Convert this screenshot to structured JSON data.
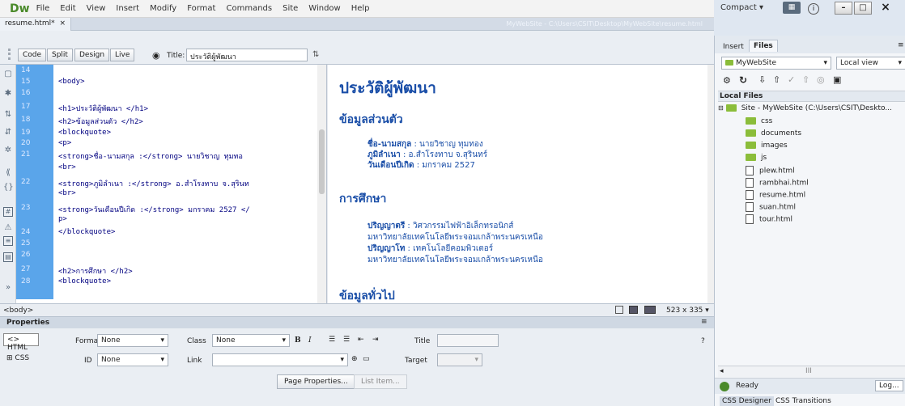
{
  "app": {
    "logo": "Dw",
    "menus": [
      "File",
      "Edit",
      "View",
      "Insert",
      "Modify",
      "Format",
      "Commands",
      "Site",
      "Window",
      "Help"
    ]
  },
  "window": {
    "workspace": "Compact",
    "workspace_arrow": "▾",
    "min": "–",
    "max": "□",
    "close": "×"
  },
  "document": {
    "tab": "resume.html*",
    "tab_close": "×",
    "path": "MyWebSite - C:\\Users\\CSIT\\Desktop\\MyWebSite\\resume.html"
  },
  "toolbar": {
    "views": [
      "Code",
      "Split",
      "Design",
      "Live"
    ],
    "title_label": "Title:",
    "title_value": "ประวัติผู้พัฒนา"
  },
  "code": {
    "lines": [
      {
        "n": "14",
        "text": ""
      },
      {
        "n": "15",
        "text": "<body>"
      },
      {
        "n": "16",
        "text": ""
      },
      {
        "n": "17",
        "text": "<h1>ประวัติผู้พัฒนา </h1>"
      },
      {
        "n": "18",
        "text": "<h2>ข้อมูลส่วนตัว </h2>"
      },
      {
        "n": "19",
        "text": "<blockquote>"
      },
      {
        "n": "20",
        "text": "  <p>"
      },
      {
        "n": "21",
        "text": "    <strong>ชื่อ-นามสกุล :</strong> นายวิชาญ ทุมทอ"
      },
      {
        "n": "",
        "text": "  <br>"
      },
      {
        "n": "22",
        "text": "    <strong>ภูมิลำเนา :</strong> อ.สำโรงทาบ จ.สุรินท"
      },
      {
        "n": "",
        "text": "  <br>"
      },
      {
        "n": "23",
        "text": "  <strong>วันเดือนปีเกิด :</strong> มกราคม 2527 </"
      },
      {
        "n": "",
        "text": "p>"
      },
      {
        "n": "24",
        "text": "</blockquote>"
      },
      {
        "n": "25",
        "text": ""
      },
      {
        "n": "26",
        "text": ""
      },
      {
        "n": "27",
        "text": "  <h2>การศึกษา </h2>"
      },
      {
        "n": "28",
        "text": "  <blockquote>"
      }
    ]
  },
  "design": {
    "h1": "ประวัติผู้พัฒนา",
    "h2_personal": "ข้อมูลส่วนตัว",
    "personal": [
      {
        "label": "ชื่อ-นามสกุล",
        "value": " : นายวิชาญ ทุมทอง"
      },
      {
        "label": "ภูมิลำเนา",
        "value": " : อ.สำโรงทาบ จ.สุรินทร์"
      },
      {
        "label": "วันเดือนปีเกิด",
        "value": " : มกราคม 2527"
      }
    ],
    "h2_edu": "การศึกษา",
    "edu": [
      {
        "label": "ปริญญาตรี",
        "value": " : วิศวกรรมไฟฟ้าอิเล็กทรอนิกส์"
      },
      {
        "label": "",
        "value": "มหาวิทยาลัยเทคโนโลยีพระจอมเกล้าพระนครเหนือ"
      },
      {
        "label": "ปริญญาโท",
        "value": " : เทคโนโลยีคอมพิวเตอร์"
      },
      {
        "label": "",
        "value": "มหาวิทยาลัยเทคโนโลยีพระจอมเกล้าพระนครเหนือ"
      }
    ],
    "h2_general": "ข้อมูลทั่วไป"
  },
  "status": {
    "tag": "<body>",
    "size": "523 x 335"
  },
  "properties": {
    "title": "Properties",
    "html_btn": "HTML",
    "css_btn": "CSS",
    "format_label": "Format",
    "format_value": "None",
    "class_label": "Class",
    "class_value": "None",
    "id_label": "ID",
    "id_value": "None",
    "link_label": "Link",
    "title_label": "Title",
    "target_label": "Target",
    "bold": "B",
    "italic": "I",
    "page_props": "Page Properties...",
    "list_item": "List Item..."
  },
  "panel": {
    "tabs": [
      "Insert",
      "Files"
    ],
    "site": "MyWebSite",
    "view": "Local view",
    "local_files": "Local Files",
    "root": "Site - MyWebSite (C:\\Users\\CSIT\\Deskto...",
    "folders": [
      "css",
      "documents",
      "images",
      "js"
    ],
    "files": [
      "plew.html",
      "rambhai.html",
      "resume.html",
      "suan.html",
      "tour.html"
    ],
    "ready": "Ready",
    "log": "Log...",
    "bottom_tabs": [
      "CSS Designer",
      "CSS Transitions"
    ]
  },
  "colors": {
    "accent": "#5aa5ea",
    "design_blue": "#1b4fa8"
  }
}
